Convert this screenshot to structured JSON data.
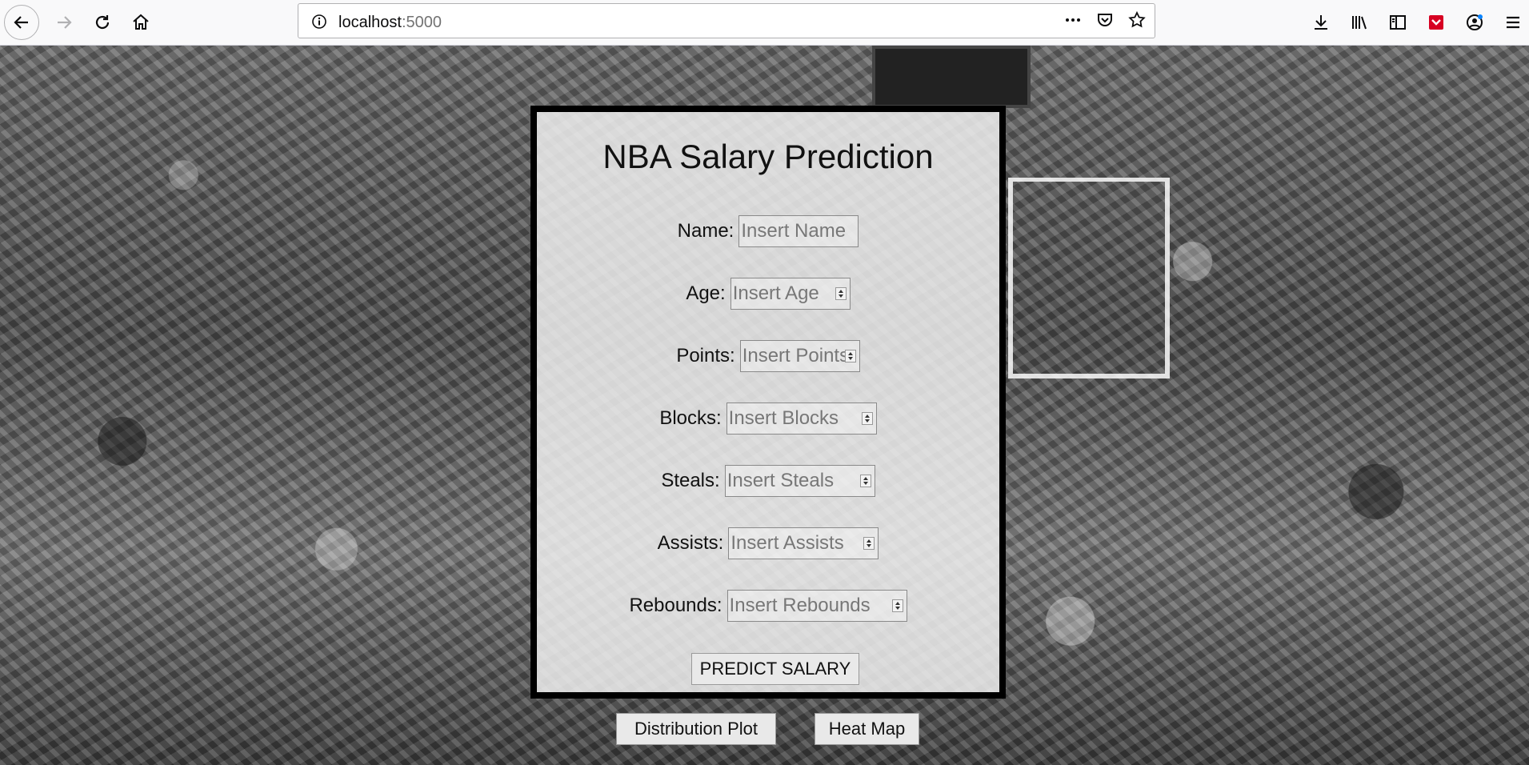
{
  "browser": {
    "url_host": "localhost",
    "url_port": ":5000"
  },
  "form": {
    "title": "NBA Salary Prediction",
    "fields": [
      {
        "label": "Name:",
        "placeholder": "Insert Name"
      },
      {
        "label": "Age:",
        "placeholder": "Insert Age"
      },
      {
        "label": "Points:",
        "placeholder": "Insert Points"
      },
      {
        "label": "Blocks:",
        "placeholder": "Insert Blocks"
      },
      {
        "label": "Steals:",
        "placeholder": "Insert Steals"
      },
      {
        "label": "Assists:",
        "placeholder": "Insert Assists"
      },
      {
        "label": "Rebounds:",
        "placeholder": "Insert Rebounds"
      }
    ],
    "submit_label": "PREDICT SALARY"
  },
  "links": {
    "distribution_label": "Distribution Plot",
    "heatmap_label": "Heat Map"
  }
}
